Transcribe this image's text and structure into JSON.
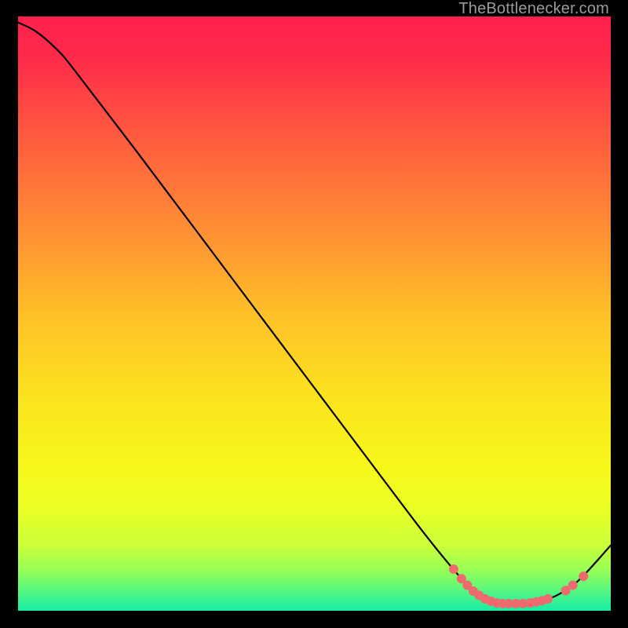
{
  "watermark": "TheBottlenecker.com",
  "chart_data": {
    "type": "line",
    "title": "",
    "xlabel": "",
    "ylabel": "",
    "xlim": [
      0,
      100
    ],
    "ylim": [
      0,
      100
    ],
    "gradient_stops": [
      {
        "offset": 0.0,
        "color": "#ff1f4e"
      },
      {
        "offset": 0.07,
        "color": "#ff2b4a"
      },
      {
        "offset": 0.2,
        "color": "#ff5a3f"
      },
      {
        "offset": 0.35,
        "color": "#ff8b34"
      },
      {
        "offset": 0.5,
        "color": "#ffc028"
      },
      {
        "offset": 0.65,
        "color": "#fbe51e"
      },
      {
        "offset": 0.76,
        "color": "#f7f81a"
      },
      {
        "offset": 0.83,
        "color": "#eaff25"
      },
      {
        "offset": 0.89,
        "color": "#caff3a"
      },
      {
        "offset": 0.93,
        "color": "#9aff55"
      },
      {
        "offset": 0.965,
        "color": "#58f77e"
      },
      {
        "offset": 1.0,
        "color": "#17eca7"
      }
    ],
    "series": [
      {
        "name": "curve",
        "points": [
          {
            "x": 0.0,
            "y": 99.0
          },
          {
            "x": 3.0,
            "y": 97.5
          },
          {
            "x": 6.5,
            "y": 94.5
          },
          {
            "x": 9.5,
            "y": 91.0
          },
          {
            "x": 20.0,
            "y": 77.3
          },
          {
            "x": 35.0,
            "y": 57.4
          },
          {
            "x": 50.0,
            "y": 37.5
          },
          {
            "x": 62.0,
            "y": 21.6
          },
          {
            "x": 68.0,
            "y": 13.7
          },
          {
            "x": 73.0,
            "y": 7.5
          },
          {
            "x": 76.0,
            "y": 4.2
          },
          {
            "x": 79.0,
            "y": 2.0
          },
          {
            "x": 82.0,
            "y": 1.2
          },
          {
            "x": 86.0,
            "y": 1.2
          },
          {
            "x": 89.0,
            "y": 1.8
          },
          {
            "x": 92.0,
            "y": 3.2
          },
          {
            "x": 95.0,
            "y": 5.5
          },
          {
            "x": 100.0,
            "y": 11.0
          }
        ]
      }
    ],
    "markers": [
      {
        "x": 73.5,
        "y": 7.0
      },
      {
        "x": 74.8,
        "y": 5.4
      },
      {
        "x": 75.8,
        "y": 4.3
      },
      {
        "x": 76.8,
        "y": 3.3
      },
      {
        "x": 77.8,
        "y": 2.6
      },
      {
        "x": 78.8,
        "y": 2.0
      },
      {
        "x": 79.8,
        "y": 1.6
      },
      {
        "x": 80.8,
        "y": 1.3
      },
      {
        "x": 81.8,
        "y": 1.2
      },
      {
        "x": 82.8,
        "y": 1.2
      },
      {
        "x": 84.0,
        "y": 1.2
      },
      {
        "x": 85.2,
        "y": 1.2
      },
      {
        "x": 86.4,
        "y": 1.3
      },
      {
        "x": 87.4,
        "y": 1.5
      },
      {
        "x": 88.4,
        "y": 1.7
      },
      {
        "x": 89.4,
        "y": 2.0
      },
      {
        "x": 92.4,
        "y": 3.4
      },
      {
        "x": 93.6,
        "y": 4.3
      },
      {
        "x": 95.4,
        "y": 5.8
      }
    ],
    "marker_color": "#ee6a6f",
    "curve_color": "#000000"
  }
}
